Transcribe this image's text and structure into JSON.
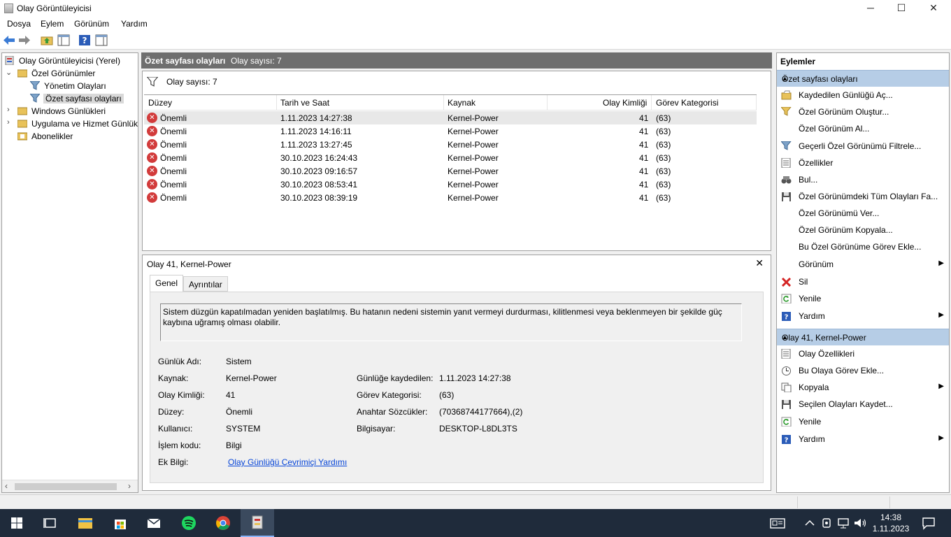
{
  "window": {
    "title": "Olay Görüntüleyicisi",
    "controls": {
      "minimize": "─",
      "maximize": "☐",
      "close": "✕"
    }
  },
  "menu": [
    "Dosya",
    "Eylem",
    "Görünüm",
    "Yardım"
  ],
  "tree": {
    "root": "Olay Görüntüleyicisi (Yerel)",
    "custom_views": "Özel Görünümler",
    "admin_events": "Yönetim Olayları",
    "summary_events": "Özet sayfası olayları",
    "windows_logs": "Windows Günlükleri",
    "app_service_logs": "Uygulama ve Hizmet Günlükleri",
    "subscriptions": "Abonelikler"
  },
  "middle": {
    "header_title": "Özet sayfası olayları",
    "header_count": "Olay sayısı: 7",
    "filter_label": "Olay sayısı: 7",
    "columns": [
      "Düzey",
      "Tarih ve Saat",
      "Kaynak",
      "Olay Kimliği",
      "Görev Kategorisi"
    ],
    "rows": [
      {
        "level": "Önemli",
        "datetime": "1.11.2023 14:27:38",
        "source": "Kernel-Power",
        "id": "41",
        "category": "(63)"
      },
      {
        "level": "Önemli",
        "datetime": "1.11.2023 14:16:11",
        "source": "Kernel-Power",
        "id": "41",
        "category": "(63)"
      },
      {
        "level": "Önemli",
        "datetime": "1.11.2023 13:27:45",
        "source": "Kernel-Power",
        "id": "41",
        "category": "(63)"
      },
      {
        "level": "Önemli",
        "datetime": "30.10.2023 16:24:43",
        "source": "Kernel-Power",
        "id": "41",
        "category": "(63)"
      },
      {
        "level": "Önemli",
        "datetime": "30.10.2023 09:16:57",
        "source": "Kernel-Power",
        "id": "41",
        "category": "(63)"
      },
      {
        "level": "Önemli",
        "datetime": "30.10.2023 08:53:41",
        "source": "Kernel-Power",
        "id": "41",
        "category": "(63)"
      },
      {
        "level": "Önemli",
        "datetime": "30.10.2023 08:39:19",
        "source": "Kernel-Power",
        "id": "41",
        "category": "(63)"
      }
    ]
  },
  "detail": {
    "title": "Olay 41, Kernel-Power",
    "close": "✕",
    "tabs": [
      "Genel",
      "Ayrıntılar"
    ],
    "description": "Sistem düzgün kapatılmadan yeniden başlatılmış. Bu hatanın nedeni sistemin yanıt vermeyi durdurması, kilitlenmesi veya beklenmeyen bir şekilde güç kaybına uğramış olması olabilir.",
    "fields": {
      "log_name_label": "Günlük Adı:",
      "log_name": "Sistem",
      "source_label": "Kaynak:",
      "source": "Kernel-Power",
      "event_id_label": "Olay Kimliği:",
      "event_id": "41",
      "level_label": "Düzey:",
      "level": "Önemli",
      "user_label": "Kullanıcı:",
      "user": "SYSTEM",
      "opcode_label": "İşlem kodu:",
      "opcode": "Bilgi",
      "more_info_label": "Ek Bilgi:",
      "more_info_link": "Olay Günlüğü Çevrimiçi Yardımı",
      "logged_label": "Günlüğe kaydedilen:",
      "logged": "1.11.2023 14:27:38",
      "task_cat_label": "Görev Kategorisi:",
      "task_cat": "(63)",
      "keywords_label": "Anahtar Sözcükler:",
      "keywords": "(70368744177664),(2)",
      "computer_label": "Bilgisayar:",
      "computer": "DESKTOP-L8DL3TS"
    }
  },
  "actions": {
    "header": "Eylemler",
    "section1": "Özet sayfası olayları",
    "section1_items": [
      "Kaydedilen Günlüğü Aç...",
      "Özel Görünüm Oluştur...",
      "Özel Görünüm Al...",
      "Geçerli Özel Görünümü Filtrele...",
      "Özellikler",
      "Bul...",
      "Özel Görünümdeki Tüm Olayları Fa...",
      "Özel Görünümü Ver...",
      "Özel Görünüm Kopyala...",
      "Bu Özel Görünüme Görev Ekle...",
      "Görünüm",
      "Sil",
      "Yenile",
      "Yardım"
    ],
    "section2": "Olay 41, Kernel-Power",
    "section2_items": [
      "Olay Özellikleri",
      "Bu Olaya Görev Ekle...",
      "Kopyala",
      "Seçilen Olayları Kaydet...",
      "Yenile",
      "Yardım"
    ]
  },
  "taskbar": {
    "time": "14:38",
    "date": "1.11.2023"
  },
  "colors": {
    "section_blue": "#b6cde6",
    "header_gray": "#6e6e6e",
    "error_red": "#d23b3b",
    "taskbar": "#1f2b3b",
    "link": "#0645d8"
  }
}
